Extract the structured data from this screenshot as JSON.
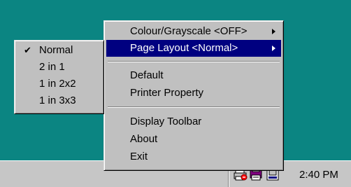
{
  "desktop": {
    "background_color": "#0b8582"
  },
  "taskbar": {
    "clock": "2:40 PM",
    "tray_icons": [
      "printer-icon",
      "printer-status-icon",
      "printer-settings-icon"
    ]
  },
  "main_menu": {
    "items": [
      {
        "label": "Colour/Grayscale <OFF>",
        "has_submenu": true
      },
      {
        "label": "Page Layout <Normal>",
        "has_submenu": true,
        "highlighted": true
      },
      {
        "label": "Default"
      },
      {
        "label": "Printer Property"
      },
      {
        "label": "Display Toolbar"
      },
      {
        "label": "About"
      },
      {
        "label": "Exit"
      }
    ]
  },
  "page_layout_submenu": {
    "selected": "Normal",
    "items": [
      {
        "label": "Normal",
        "checked": true
      },
      {
        "label": "2 in 1"
      },
      {
        "label": "1 in 2x2"
      },
      {
        "label": "1 in 3x3"
      }
    ]
  },
  "colors": {
    "highlight": "#000080",
    "menu_face": "#c0c0c0"
  }
}
